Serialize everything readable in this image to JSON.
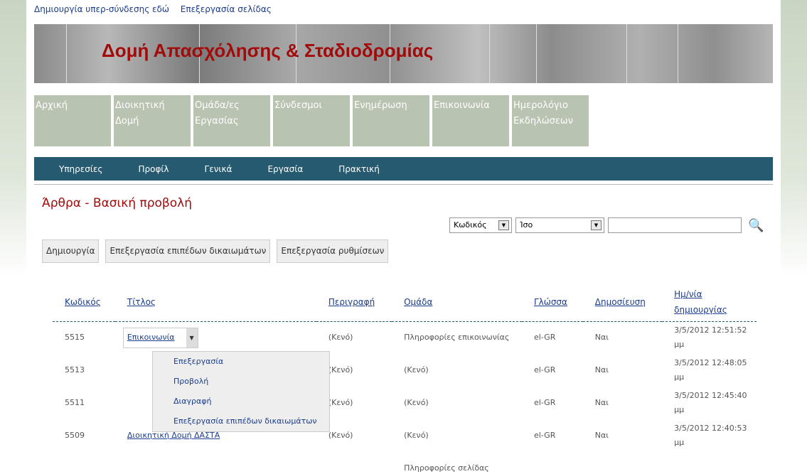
{
  "top_links": [
    "Δημιουργία υπερ-σύνδεσης εδώ",
    "Επεξεργασία σελίδας"
  ],
  "banner_title": "Δομή Απασχόλησης & Σταδιοδρομίας",
  "tiles": [
    "Αρχική",
    "Διοικητική Δομή",
    "Ομάδα/ες Εργασίας",
    "Σύνδεσμοι",
    "Ενημέρωση",
    "Επικοινωνία",
    "Ημερολόγιο Εκδηλώσεων"
  ],
  "nav": [
    "Υπηρεσίες",
    "Προφίλ",
    "Γενικά",
    "Εργασία",
    "Πρακτική"
  ],
  "page_title": "Άρθρα - Βασική προβολή",
  "filter": {
    "field": "Κωδικός",
    "operator": "Ίσο",
    "value": ""
  },
  "buttons": [
    "Δημιουργία",
    "Επεξεργασία επιπέδων δικαιωμάτων",
    "Επεξεργασία ρυθμίσεων"
  ],
  "columns": [
    "Κωδικός",
    "Τίτλος",
    "Περιγραφή",
    "Ομάδα",
    "Γλώσσα",
    "Δημοσίευση",
    "Ημ/νία δημιουργίας"
  ],
  "rows": [
    {
      "id": "5515",
      "title": "Επικοινωνία",
      "desc": "(Κενό)",
      "group": "Πληροφορίες επικοινωνίας",
      "lang": "el-GR",
      "pub": "Ναι",
      "date": "3/5/2012 12:51:52 μμ"
    },
    {
      "id": "5513",
      "title": "",
      "desc": "(Κενό)",
      "group": "(Κενό)",
      "lang": "el-GR",
      "pub": "Ναι",
      "date": "3/5/2012 12:48:05 μμ"
    },
    {
      "id": "5511",
      "title": "",
      "desc": "(Κενό)",
      "group": "(Κενό)",
      "lang": "el-GR",
      "pub": "Ναι",
      "date": "3/5/2012 12:45:40 μμ"
    },
    {
      "id": "5509",
      "title": "Διοικητική Δομή ΔΑΣΤΑ",
      "desc": "(Κενό)",
      "group": "(Κενό)",
      "lang": "el-GR",
      "pub": "Ναι",
      "date": "3/5/2012 12:40:53 μμ"
    },
    {
      "id": "",
      "title": "",
      "desc": "",
      "group": "Πληροφορίες σελίδας",
      "lang": "",
      "pub": "",
      "date": ""
    }
  ],
  "context_menu": [
    "Επεξεργασία",
    "Προβολή",
    "Διαγραφή",
    "Επεξεργασία επιπέδων δικαιωμάτων"
  ]
}
